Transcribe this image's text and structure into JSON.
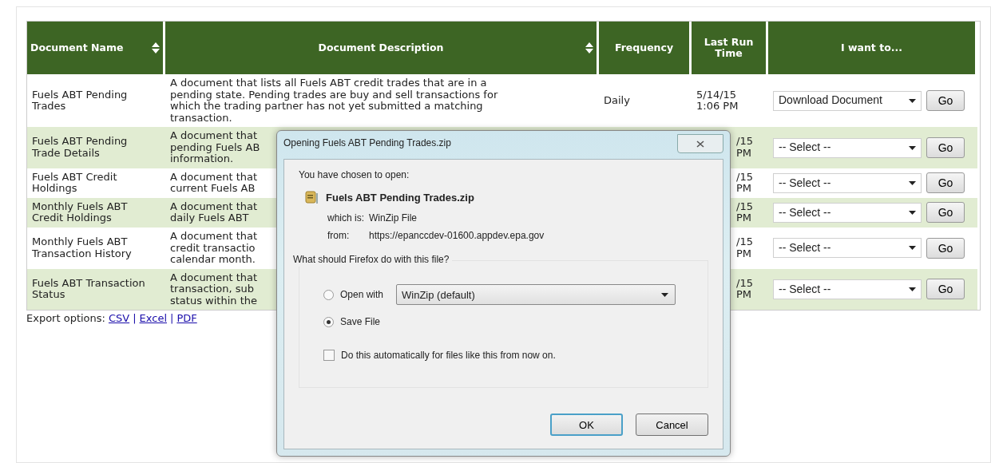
{
  "table": {
    "columns": [
      {
        "label": "Document Name",
        "sortable": true
      },
      {
        "label": "Document Description",
        "sortable": true
      },
      {
        "label": "Frequency",
        "sortable": false
      },
      {
        "label": "Last Run Time",
        "sortable": false
      },
      {
        "label": "I want to...",
        "sortable": false
      }
    ],
    "rows": [
      {
        "name": "Fuels ABT Pending Trades",
        "description": [
          "A document that lists all Fuels ABT credit trades that are in a",
          "pending state. Pending trades are buy and sell transactions for",
          "which the trading partner has not yet submitted a matching",
          "transaction."
        ],
        "frequency": "Daily",
        "last_run": [
          "5/14/15",
          "1:06 PM"
        ],
        "covered": false,
        "action": "Download Document",
        "go": "Go"
      },
      {
        "name": "Fuels ABT Pending Trade Details",
        "description": [
          "A document that",
          "pending Fuels AB",
          "information."
        ],
        "last_run": [
          "/15",
          "PM"
        ],
        "covered": true,
        "action": "-- Select --",
        "go": "Go"
      },
      {
        "name": "Fuels ABT Credit Holdings",
        "description": [
          "A document that",
          "current Fuels AB"
        ],
        "last_run": [
          "/15",
          "PM"
        ],
        "covered": true,
        "action": "-- Select --",
        "go": "Go"
      },
      {
        "name": "Monthly Fuels ABT Credit Holdings",
        "description": [
          "A document that",
          "daily Fuels ABT"
        ],
        "last_run": [
          "/15",
          "PM"
        ],
        "covered": true,
        "action": "-- Select --",
        "go": "Go"
      },
      {
        "name": "Monthly Fuels ABT Transaction History",
        "description": [
          "A document that",
          "credit transactio",
          "calendar month."
        ],
        "last_run": [
          "/15",
          "PM"
        ],
        "covered": true,
        "action": "-- Select --",
        "go": "Go"
      },
      {
        "name": "Fuels ABT Transaction Status",
        "description": [
          "A document that",
          "transaction, sub",
          "status within the"
        ],
        "last_run": [
          "/15",
          "PM"
        ],
        "covered": true,
        "action": "-- Select --",
        "go": "Go"
      }
    ]
  },
  "export": {
    "label": "Export options:",
    "links": [
      "CSV",
      "Excel",
      "PDF"
    ],
    "separator": "|"
  },
  "dialog": {
    "title": "Opening Fuels ABT Pending Trades.zip",
    "intro": "You have chosen to open:",
    "file_name": "Fuels ABT Pending Trades.zip",
    "which_is_label": "which is:",
    "which_is": "WinZip File",
    "from_label": "from:",
    "from": "https://epanccdev-01600.appdev.epa.gov",
    "question": "What should Firefox do with this file?",
    "options": [
      {
        "label": "Open with",
        "selected": false,
        "app": "WinZip (default)"
      },
      {
        "label": "Save File",
        "selected": true
      }
    ],
    "auto": {
      "label": "Do this automatically for files like this from now on.",
      "checked": false
    },
    "buttons": [
      {
        "label": "OK",
        "default": true
      },
      {
        "label": "Cancel",
        "default": false
      }
    ]
  }
}
